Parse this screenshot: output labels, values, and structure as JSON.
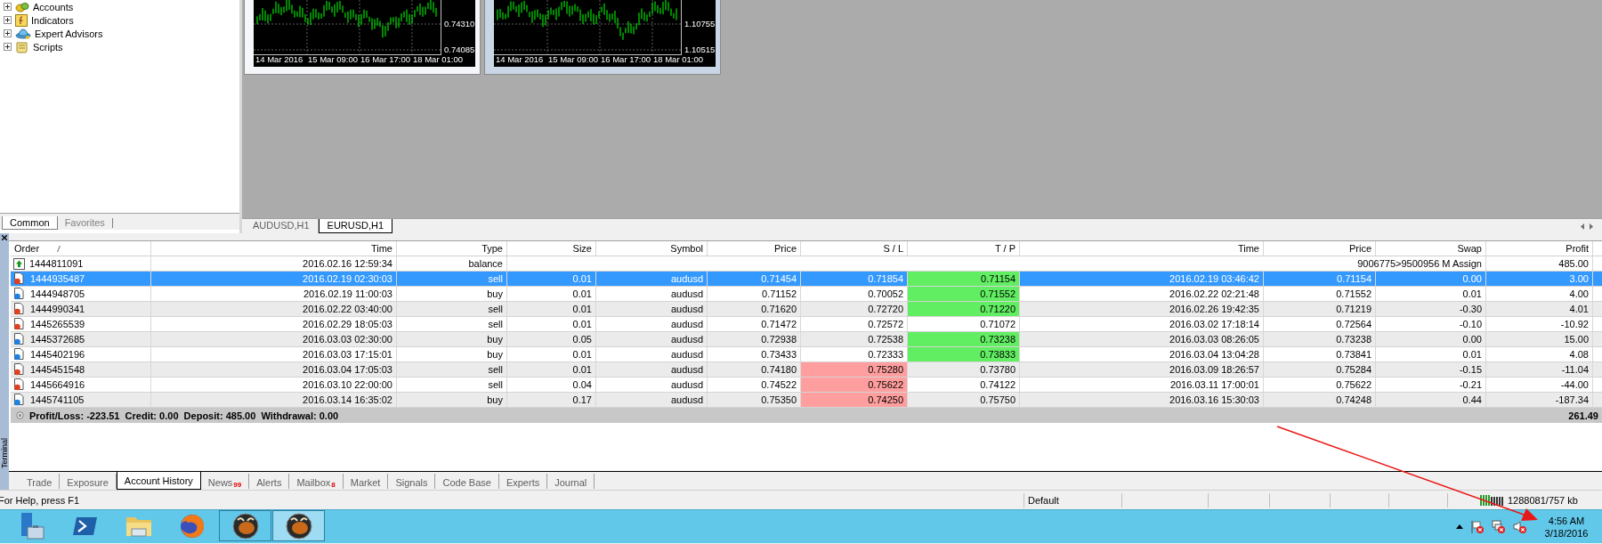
{
  "navigator": {
    "items": [
      {
        "label": "Accounts",
        "kind": "accounts"
      },
      {
        "label": "Indicators",
        "kind": "indicators"
      },
      {
        "label": "Expert Advisors",
        "kind": "experts"
      },
      {
        "label": "Scripts",
        "kind": "scripts"
      }
    ],
    "tabs": [
      {
        "label": "Common",
        "selected": true
      },
      {
        "label": "Favorites",
        "selected": false
      }
    ]
  },
  "charts": [
    {
      "selected": false,
      "yticks": [
        "0.74310",
        "0.74085"
      ],
      "xlabels": [
        "14 Mar 2016",
        "15 Mar 09:00",
        "16 Mar 17:00",
        "18 Mar 01:00"
      ]
    },
    {
      "selected": true,
      "yticks": [
        "1.10755",
        "1.10515"
      ],
      "xlabels": [
        "14 Mar 2016",
        "15 Mar 09:00",
        "16 Mar 17:00",
        "18 Mar 01:00"
      ]
    }
  ],
  "chart_tabs": [
    {
      "label": "AUDUSD,H1",
      "selected": false
    },
    {
      "label": "EURUSD,H1",
      "selected": true
    }
  ],
  "terminal": {
    "title": "Terminal",
    "columns": [
      "Order",
      "Time",
      "Type",
      "Size",
      "Symbol",
      "Price",
      "S / L",
      "T / P",
      "Time",
      "Price",
      "Swap",
      "Profit"
    ],
    "rows": [
      {
        "kind": "balance",
        "selected": false,
        "order": "1444811091",
        "time": "2016.02.16 12:59:34",
        "type": "balance",
        "comment": "9006775>9500956 M Assign",
        "profit": "485.00"
      },
      {
        "kind": "sell",
        "selected": true,
        "sl_hit": false,
        "tp_hit": true,
        "order": "1444935487",
        "time": "2016.02.19 02:30:03",
        "type": "sell",
        "size": "0.01",
        "symbol": "audusd",
        "price": "0.71454",
        "sl": "0.71854",
        "tp": "0.71154",
        "close_time": "2016.02.19 03:46:42",
        "close_price": "0.71154",
        "swap": "0.00",
        "profit": "3.00"
      },
      {
        "kind": "buy",
        "selected": false,
        "sl_hit": false,
        "tp_hit": true,
        "order": "1444948705",
        "time": "2016.02.19 11:00:03",
        "type": "buy",
        "size": "0.01",
        "symbol": "audusd",
        "price": "0.71152",
        "sl": "0.70052",
        "tp": "0.71552",
        "close_time": "2016.02.22 02:21:48",
        "close_price": "0.71552",
        "swap": "0.01",
        "profit": "4.00"
      },
      {
        "kind": "sell",
        "selected": false,
        "sl_hit": false,
        "tp_hit": true,
        "order": "1444990341",
        "time": "2016.02.22 03:40:00",
        "type": "sell",
        "size": "0.01",
        "symbol": "audusd",
        "price": "0.71620",
        "sl": "0.72720",
        "tp": "0.71220",
        "close_time": "2016.02.26 19:42:35",
        "close_price": "0.71219",
        "swap": "-0.30",
        "profit": "4.01"
      },
      {
        "kind": "sell",
        "selected": false,
        "sl_hit": false,
        "tp_hit": false,
        "order": "1445265539",
        "time": "2016.02.29 18:05:03",
        "type": "sell",
        "size": "0.01",
        "symbol": "audusd",
        "price": "0.71472",
        "sl": "0.72572",
        "tp": "0.71072",
        "close_time": "2016.03.02 17:18:14",
        "close_price": "0.72564",
        "swap": "-0.10",
        "profit": "-10.92"
      },
      {
        "kind": "buy",
        "selected": false,
        "sl_hit": false,
        "tp_hit": true,
        "order": "1445372685",
        "time": "2016.03.03 02:30:00",
        "type": "buy",
        "size": "0.05",
        "symbol": "audusd",
        "price": "0.72938",
        "sl": "0.72538",
        "tp": "0.73238",
        "close_time": "2016.03.03 08:26:05",
        "close_price": "0.73238",
        "swap": "0.00",
        "profit": "15.00"
      },
      {
        "kind": "buy",
        "selected": false,
        "sl_hit": false,
        "tp_hit": true,
        "order": "1445402196",
        "time": "2016.03.03 17:15:01",
        "type": "buy",
        "size": "0.01",
        "symbol": "audusd",
        "price": "0.73433",
        "sl": "0.72333",
        "tp": "0.73833",
        "close_time": "2016.03.04 13:04:28",
        "close_price": "0.73841",
        "swap": "0.01",
        "profit": "4.08"
      },
      {
        "kind": "sell",
        "selected": false,
        "sl_hit": true,
        "tp_hit": false,
        "order": "1445451548",
        "time": "2016.03.04 17:05:03",
        "type": "sell",
        "size": "0.01",
        "symbol": "audusd",
        "price": "0.74180",
        "sl": "0.75280",
        "tp": "0.73780",
        "close_time": "2016.03.09 18:26:57",
        "close_price": "0.75284",
        "swap": "-0.15",
        "profit": "-11.04"
      },
      {
        "kind": "sell",
        "selected": false,
        "sl_hit": true,
        "tp_hit": false,
        "order": "1445664916",
        "time": "2016.03.10 22:00:00",
        "type": "sell",
        "size": "0.04",
        "symbol": "audusd",
        "price": "0.74522",
        "sl": "0.75622",
        "tp": "0.74122",
        "close_time": "2016.03.11 17:00:01",
        "close_price": "0.75622",
        "swap": "-0.21",
        "profit": "-44.00"
      },
      {
        "kind": "buy",
        "selected": false,
        "sl_hit": true,
        "tp_hit": false,
        "order": "1445741105",
        "time": "2016.03.14 16:35:02",
        "type": "buy",
        "size": "0.17",
        "symbol": "audusd",
        "price": "0.75350",
        "sl": "0.74250",
        "tp": "0.75750",
        "close_time": "2016.03.16 15:30:03",
        "close_price": "0.74248",
        "swap": "0.44",
        "profit": "-187.34"
      }
    ],
    "summary": {
      "text": "Profit/Loss: -223.51  Credit: 0.00  Deposit: 485.00  Withdrawal: 0.00",
      "total": "261.49"
    },
    "tabs": [
      {
        "label": "Trade",
        "selected": false
      },
      {
        "label": "Exposure",
        "selected": false
      },
      {
        "label": "Account History",
        "selected": true
      },
      {
        "label": "News",
        "badge": "99",
        "selected": false
      },
      {
        "label": "Alerts",
        "selected": false
      },
      {
        "label": "Mailbox",
        "badge": "8",
        "selected": false
      },
      {
        "label": "Market",
        "selected": false
      },
      {
        "label": "Signals",
        "selected": false
      },
      {
        "label": "Code Base",
        "selected": false
      },
      {
        "label": "Experts",
        "selected": false
      },
      {
        "label": "Journal",
        "selected": false
      }
    ]
  },
  "status_bar": {
    "help": "For Help, press F1",
    "profile": "Default",
    "traffic": "1288081/757 kb"
  },
  "taskbar": {
    "apps": [
      {
        "kind": "server",
        "running": false,
        "selected": false
      },
      {
        "kind": "shell",
        "running": false,
        "selected": false
      },
      {
        "kind": "folder",
        "running": false,
        "selected": false
      },
      {
        "kind": "browser",
        "running": false,
        "selected": false
      },
      {
        "kind": "terminal",
        "running": true,
        "selected": false
      },
      {
        "kind": "terminal",
        "running": true,
        "selected": true
      }
    ],
    "clock": {
      "time": "4:56 AM",
      "date": "3/18/2016"
    }
  }
}
